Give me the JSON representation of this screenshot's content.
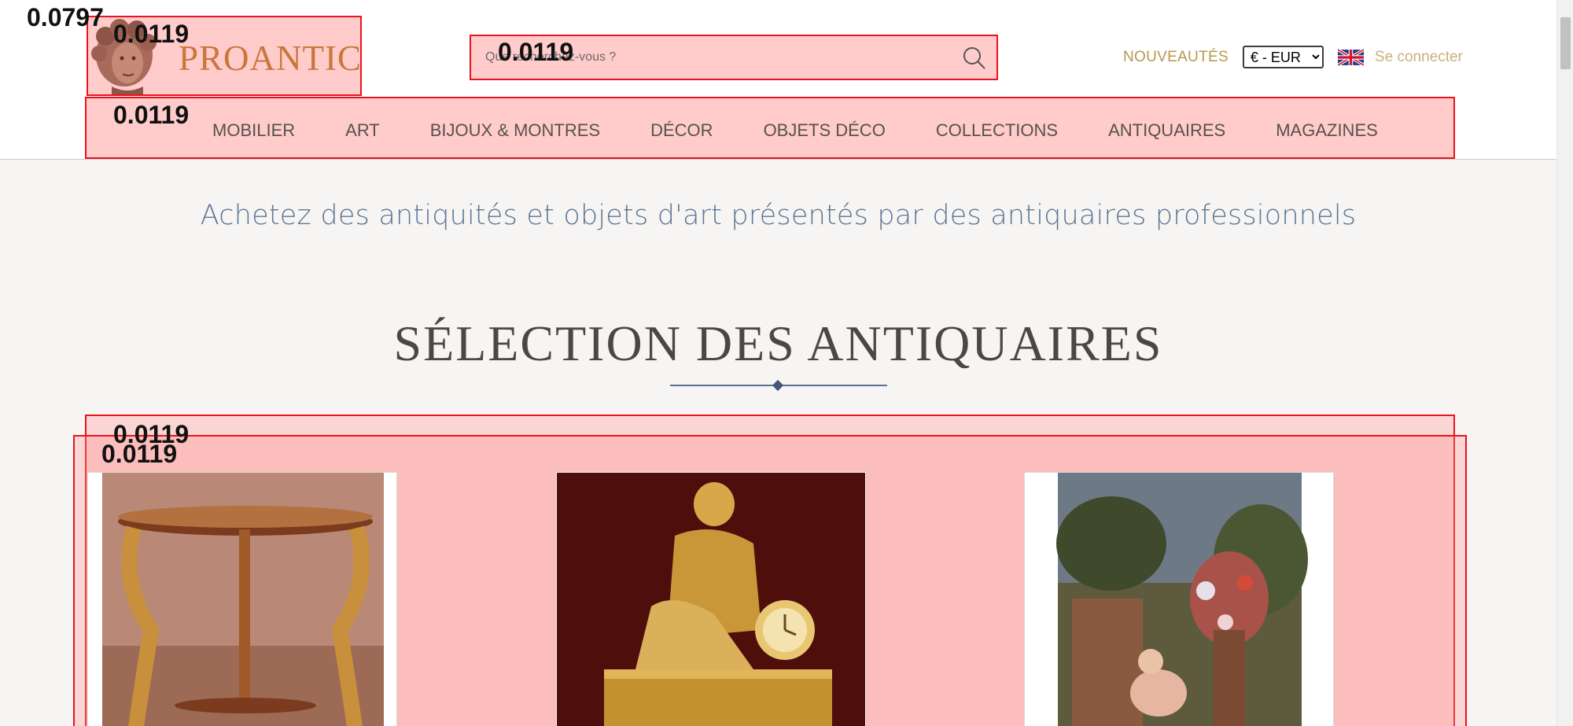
{
  "header": {
    "logo_text": "PROANTIC",
    "search_placeholder": "Que recherchez-vous ?",
    "new_label": "NOUVEAUTÉS",
    "currency_selected": "€ - EUR",
    "login_label": "Se connecter"
  },
  "nav": {
    "items": [
      "MOBILIER",
      "ART",
      "BIJOUX & MONTRES",
      "DÉCOR",
      "OBJETS DÉCO",
      "COLLECTIONS",
      "ANTIQUAIRES",
      "MAGAZINES"
    ]
  },
  "main": {
    "tagline": "Achetez des antiquités et objets d'art présentés par des antiquaires professionnels",
    "section_title": "SÉLECTION DES ANTIQUAIRES"
  },
  "overlay_labels": {
    "page": "0.0797",
    "logo": "0.0119",
    "search": "0.0119",
    "nav": "0.0119",
    "selection_outer": "0.0119",
    "selection_inner": "0.0119"
  },
  "icons": {
    "search": "search-icon",
    "flag": "uk-flag-icon",
    "logo": "bust-logo-icon"
  },
  "colors": {
    "accent_gold": "#b5984e",
    "login_gold": "#c8b27d",
    "tagline_blue": "#5e7795",
    "logo_orange": "#c9773a",
    "highlight_border": "#e8131d"
  }
}
